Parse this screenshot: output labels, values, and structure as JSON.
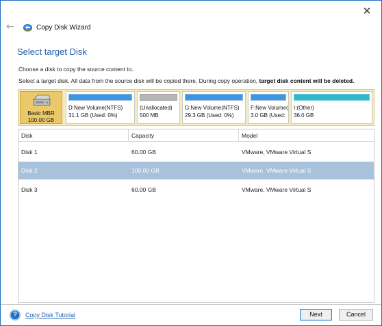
{
  "window": {
    "title": "Copy Disk Wizard",
    "close_glyph": "✕",
    "back_glyph": "←",
    "app_icon": "copy-disk-wizard-icon"
  },
  "page": {
    "heading": "Select target Disk",
    "hint_1": "Choose a disk to copy the source content to.",
    "hint_2_plain": "Select a target disk. All data from the source disk will be copied there. During copy operation, ",
    "hint_2_bold": "target disk content will be deleted."
  },
  "disk_map": {
    "disk": {
      "line1": "Basic MBR",
      "line2": "100.00 GB",
      "icon": "hard-drive-icon"
    },
    "partitions": [
      {
        "line1": "D:New Volume(NTFS)",
        "line2": "31.1 GB (Used: 0%)",
        "bar_color": "#3d97e0"
      },
      {
        "line1": "(Unallocated)",
        "line2": "500 MB",
        "bar_color": "#b6b6b6"
      },
      {
        "line1": "G:New Volume(NTFS)",
        "line2": "29.3 GB (Used: 0%)",
        "bar_color": "#3d97e0"
      },
      {
        "line1": "F:New Volume(",
        "line2": "3.0 GB (Used:",
        "bar_color": "#3d97e0"
      },
      {
        "line1": "I:(Other)",
        "line2": "36.0 GB",
        "bar_color": "#2eb8c9"
      }
    ]
  },
  "table": {
    "columns": [
      "Disk",
      "Capacity",
      "Model"
    ],
    "rows": [
      {
        "disk": "Disk 1",
        "capacity": "60.00 GB",
        "model": "VMware, VMware Virtual S",
        "selected": false
      },
      {
        "disk": "Disk 2",
        "capacity": "100.00 GB",
        "model": "VMware, VMware Virtual S",
        "selected": true
      },
      {
        "disk": "Disk 3",
        "capacity": "60.00 GB",
        "model": "VMware, VMware Virtual S",
        "selected": false
      }
    ]
  },
  "footer": {
    "help_glyph": "?",
    "tutorial_link": "Copy Disk Tutorial",
    "next_label": "Next",
    "cancel_label": "Cancel"
  },
  "colors": {
    "accent": "#1e5fa8",
    "selection": "#a9c2dc",
    "disk_map_bg": "#f6ebbc",
    "disk_tile": "#ebc96a"
  }
}
